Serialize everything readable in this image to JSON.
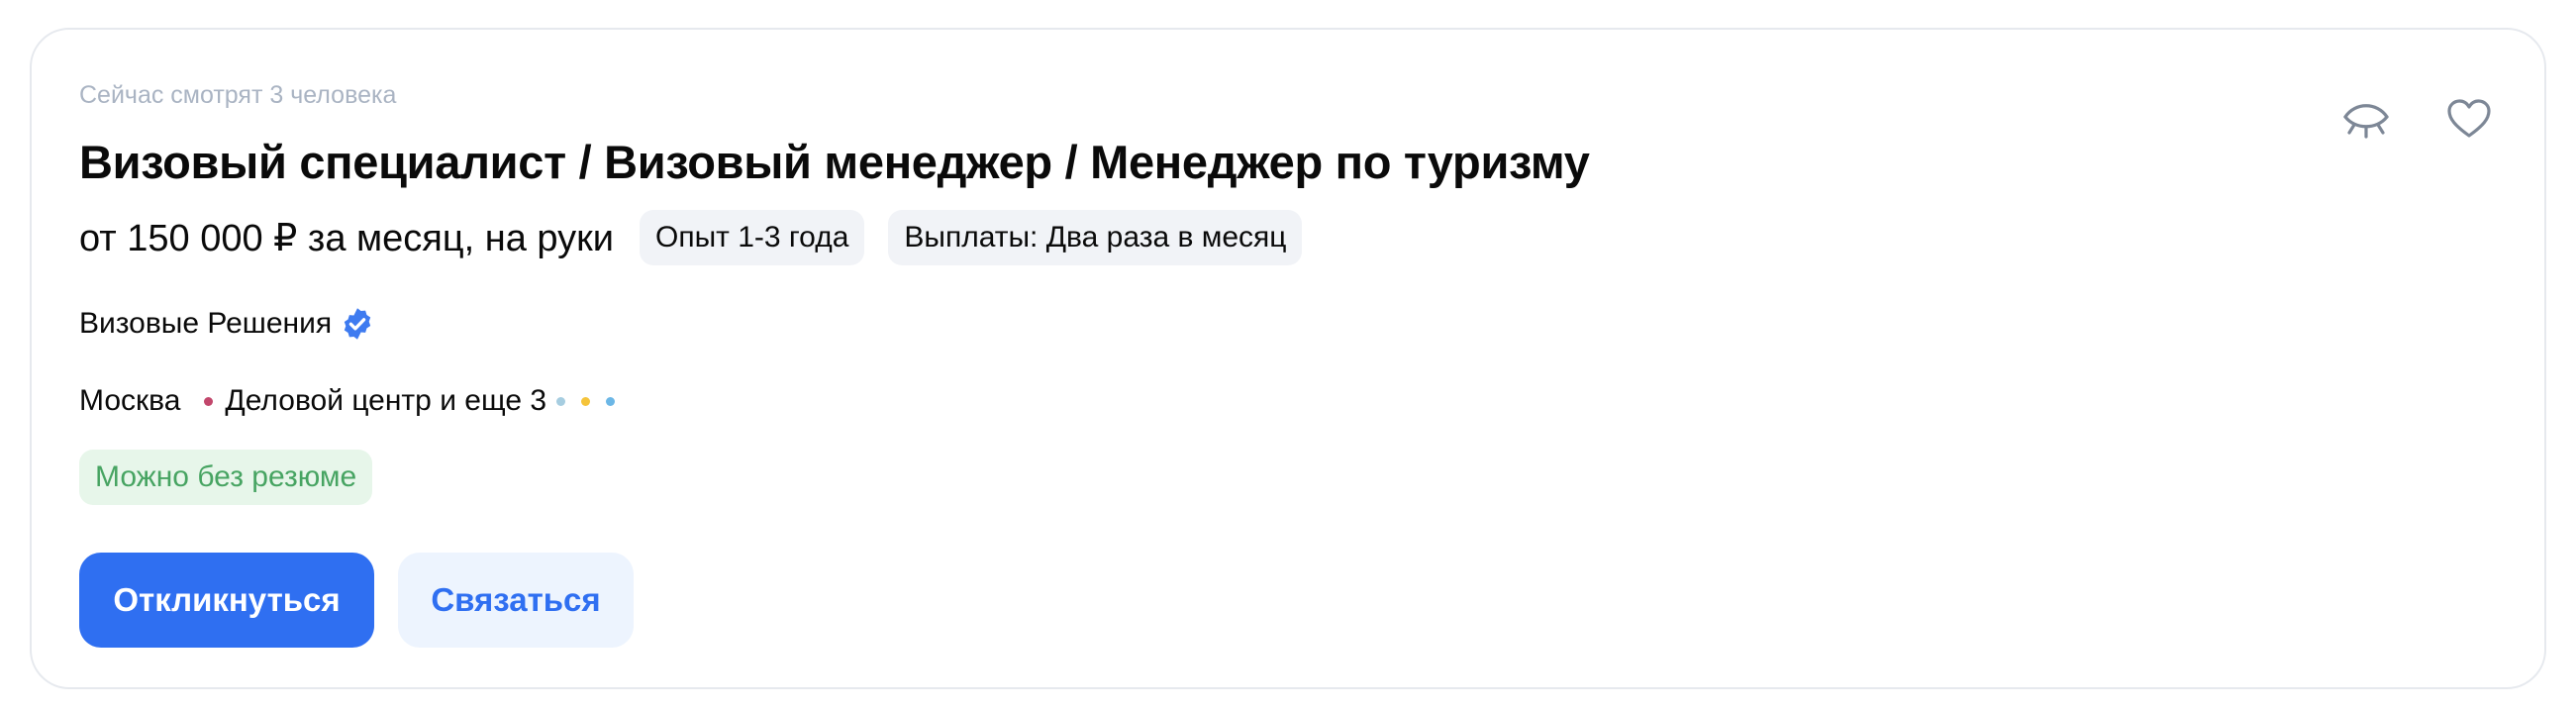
{
  "vacancy": {
    "viewers_text": "Сейчас смотрят 3 человека",
    "title": "Визовый специалист / Визовый менеджер / Менеджер по туризму",
    "salary": "от 150 000 ₽ за месяц, на руки",
    "tags": {
      "experience": "Опыт 1-3 года",
      "payouts": "Выплаты: Два раза в месяц"
    },
    "company": {
      "name": "Визовые Решения",
      "verified_icon": "verified-badge-icon"
    },
    "location": {
      "city": "Москва",
      "metro_text": "Деловой центр и еще 3",
      "metro_colors": {
        "main": "#c2476c",
        "extra_1": "#a6cde0",
        "extra_2": "#f5c43b",
        "extra_3": "#6cb7e6"
      }
    },
    "no_resume_badge": "Можно без резюме",
    "actions": {
      "respond_label": "Откликнуться",
      "contact_label": "Связаться"
    },
    "icons": {
      "hide": "eye-closed-icon",
      "favorite": "heart-icon"
    },
    "colors": {
      "accent": "#2f6ff1",
      "secondary_bg": "#edf4fe",
      "badge_bg": "#e7f6ea",
      "badge_text": "#47a462",
      "muted_text": "#aab4c3",
      "chip_bg": "#f1f3f7"
    }
  }
}
